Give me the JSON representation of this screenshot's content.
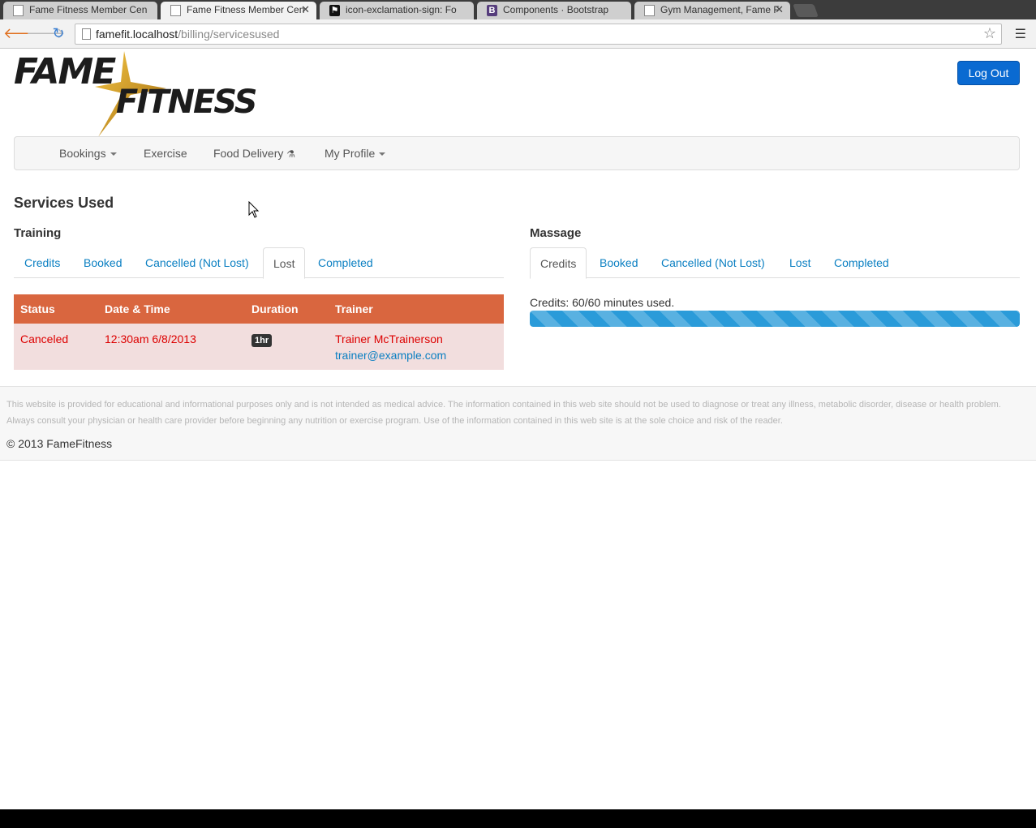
{
  "browser": {
    "tabs": [
      {
        "title": "Fame Fitness Member Cen",
        "favicon": "document-icon"
      },
      {
        "title": "Fame Fitness Member Cen",
        "favicon": "document-icon"
      },
      {
        "title": "icon-exclamation-sign: Fo",
        "favicon": "flag-icon"
      },
      {
        "title": "Components · Bootstrap",
        "favicon": "bootstrap-icon"
      },
      {
        "title": "Gym Management, Fame F",
        "favicon": "document-icon"
      }
    ],
    "url_host": "famefit.localhost",
    "url_path": "/billing/servicesused"
  },
  "logo": {
    "line1": "FAME",
    "line2": "FITNESS"
  },
  "header": {
    "logout_label": "Log Out"
  },
  "nav": {
    "bookings": "Bookings",
    "exercise": "Exercise",
    "food_delivery": "Food Delivery",
    "my_profile": "My Profile"
  },
  "page_title": "Services Used",
  "training": {
    "heading": "Training",
    "tabs": [
      "Credits",
      "Booked",
      "Cancelled (Not Lost)",
      "Lost",
      "Completed"
    ],
    "active_tab": "Lost",
    "columns": [
      "Status",
      "Date & Time",
      "Duration",
      "Trainer"
    ],
    "rows": [
      {
        "status": "Canceled",
        "datetime": "12:30am 6/8/2013",
        "duration": "1hr",
        "trainer_name": "Trainer McTrainerson",
        "trainer_email": "trainer@example.com"
      }
    ]
  },
  "massage": {
    "heading": "Massage",
    "tabs": [
      "Credits",
      "Booked",
      "Cancelled (Not Lost)",
      "Lost",
      "Completed"
    ],
    "active_tab": "Credits",
    "credits_text": "Credits: 60/60 minutes used.",
    "progress_fraction": 1.0
  },
  "footer": {
    "disclaimer": "This website is provided for educational and informational purposes only and is not intended as medical advice. The information contained in this web site should not be used to diagnose or treat any illness, metabolic disorder, disease or health problem. Always consult your physician or health care provider before beginning any nutrition or exercise program. Use of the information contained in this web site is at the sole choice and risk of the reader.",
    "copyright": "© 2013 FameFitness"
  },
  "colors": {
    "table_header": "#d9663f",
    "row_danger": "#f2dede",
    "link": "#0a7fc2",
    "primary_button": "#0a6ad1",
    "progress": "#2a9bd9"
  }
}
